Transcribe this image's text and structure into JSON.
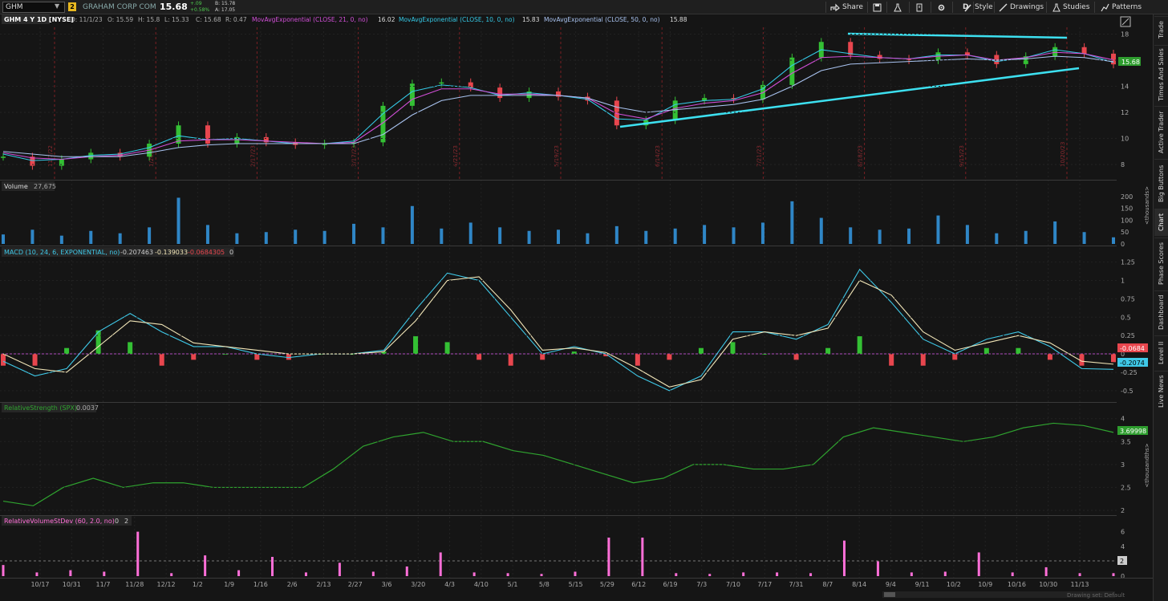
{
  "symbol": "GHM",
  "link_badge": "2",
  "company": "GRAHAM CORP COM",
  "last_price": "15.68",
  "change_abs": "+.09",
  "change_pct": "+0.58%",
  "bid": "B: 15.78",
  "ask": "A: 17.05",
  "toolbar": {
    "share": "Share",
    "period": "D",
    "style": "Style",
    "drawings": "Drawings",
    "studies": "Studies",
    "patterns": "Patterns"
  },
  "price_header": {
    "title": "GHM 4 Y 1D [NYSE]",
    "ohlc": [
      "D: 11/1/23",
      "O: 15.59",
      "H: 15.8",
      "L: 15.33",
      "C: 15.68",
      "R: 0.47"
    ],
    "ema21": "MovAvgExponential (CLOSE, 21, 0, no)",
    "ema21_val": "16.02",
    "ema10": "MovAvgExponential (CLOSE, 10, 0, no)",
    "ema10_val": "15.83",
    "ema50": "MovAvgExponential (CLOSE, 50, 0, no)",
    "ema50_val": "15.88"
  },
  "price_axis": [
    "18",
    "16",
    "14",
    "12",
    "10",
    "8"
  ],
  "price_badge": "15.68",
  "volume_header": {
    "title": "Volume",
    "value": "27,675"
  },
  "volume_axis": [
    "200",
    "150",
    "100",
    "50",
    "0"
  ],
  "volume_unit": "<thousands>",
  "macd_header": {
    "title": "MACD (10, 24, 6, EXPONENTIAL, no)",
    "v1": "-0.207463",
    "v2": "-0.139033",
    "v3": "-0.0684305",
    "v4": "0"
  },
  "macd_axis": [
    "1.25",
    "1",
    "0.75",
    "0.5",
    "0.25",
    "0",
    "-0.25",
    "-0.5"
  ],
  "macd_badges": [
    "-0.0684",
    "-0.2074"
  ],
  "rs_header": {
    "title": "RelativeStrength (SPX)",
    "value": "0.0037"
  },
  "rs_axis": [
    "4",
    "3.5",
    "3",
    "2.5",
    "2"
  ],
  "rs_badge": "3.69998",
  "rs_unit": "<thousandths>",
  "rvsd_header": {
    "title": "RelativeVolumeStDev (60, 2.0, no)",
    "v1": "0",
    "v2": "2"
  },
  "rvsd_axis": [
    "6",
    "4",
    "2",
    "0"
  ],
  "rvsd_badge": "2",
  "x_axis": [
    "10/17",
    "10/31",
    "11/7",
    "11/28",
    "12/12",
    "1/2",
    "1/9",
    "1/16",
    "2/6",
    "2/13",
    "2/27",
    "3/6",
    "3/20",
    "4/3",
    "4/10",
    "5/1",
    "5/8",
    "5/15",
    "5/29",
    "6/12",
    "6/19",
    "7/3",
    "7/10",
    "7/17",
    "7/31",
    "8/7",
    "8/14",
    "9/4",
    "9/11",
    "10/2",
    "10/9",
    "10/16",
    "10/30",
    "11/13"
  ],
  "earnings_labels": [
    "11/7/22",
    "1/26/23",
    "2/17/23",
    "3/17/23",
    "4/21/23",
    "5/19/23",
    "6/14/23",
    "7/21/23",
    "8/18/23",
    "9/15/23",
    "10/20/23"
  ],
  "footer_drawing_set": "Drawing set: Default",
  "sidebar": [
    "Trade",
    "Times And Sales",
    "Active Trader",
    "Big Buttons",
    "Chart",
    "Phase Scores",
    "Dashboard",
    "Level II",
    "Live News"
  ],
  "colors": {
    "up": "#34c034",
    "down": "#e8464e",
    "ema21": "#d24fd8",
    "ema10": "#35c9e6",
    "ema50": "#a9c3f0",
    "trendline": "#3de0f0",
    "macd_line": "#3fc9e8",
    "signal_line": "#f2e6b8",
    "rs": "#2fa32f",
    "volume": "#2f86c6",
    "rvsd": "#ff6fd8"
  },
  "chart_data": [
    {
      "type": "candlestick",
      "title": "GHM 4 Y 1D [NYSE]",
      "ylim": [
        7.2,
        18.4
      ],
      "x_ticks": [
        "10/17",
        "10/31",
        "11/7",
        "11/28",
        "12/12",
        "1/2",
        "1/9",
        "1/16",
        "2/6",
        "2/13",
        "2/27",
        "3/6",
        "3/20",
        "4/3",
        "4/10",
        "5/1",
        "5/8",
        "5/15",
        "5/29",
        "6/12",
        "6/19",
        "7/3",
        "7/10",
        "7/17",
        "7/31",
        "8/7",
        "8/14",
        "9/4",
        "9/11",
        "10/2",
        "10/9",
        "10/16",
        "10/30",
        "11/13"
      ],
      "series": [
        {
          "name": "Close",
          "values": [
            8.6,
            7.9,
            8.4,
            8.9,
            8.6,
            9.6,
            11.0,
            9.6,
            10.1,
            9.7,
            9.5,
            9.6,
            9.7,
            12.5,
            14.2,
            14.3,
            13.9,
            13.1,
            13.6,
            13.2,
            12.9,
            11.0,
            11.4,
            12.9,
            13.1,
            13.0,
            14.1,
            16.2,
            17.4,
            16.4,
            16.1,
            16.0,
            16.6,
            16.4,
            15.7,
            16.3,
            17.0,
            16.5,
            15.68
          ]
        },
        {
          "name": "MovAvgExponential (CLOSE, 10, 0, no)",
          "values": [
            8.8,
            8.3,
            8.4,
            8.7,
            8.8,
            9.3,
            10.2,
            9.9,
            10.0,
            9.8,
            9.6,
            9.6,
            9.8,
            11.9,
            13.6,
            14.1,
            13.9,
            13.3,
            13.5,
            13.3,
            13.0,
            11.5,
            11.4,
            12.6,
            12.9,
            13.0,
            13.8,
            15.6,
            16.8,
            16.5,
            16.2,
            16.1,
            16.4,
            16.4,
            15.9,
            16.2,
            16.8,
            16.5,
            15.83
          ]
        },
        {
          "name": "MovAvgExponential (CLOSE, 21, 0, no)",
          "values": [
            8.9,
            8.5,
            8.4,
            8.6,
            8.7,
            9.1,
            9.8,
            9.9,
            9.9,
            9.8,
            9.7,
            9.6,
            9.7,
            11.2,
            13.0,
            13.8,
            13.8,
            13.4,
            13.4,
            13.3,
            13.1,
            11.9,
            11.5,
            12.3,
            12.7,
            12.9,
            13.5,
            15.0,
            16.2,
            16.3,
            16.2,
            16.1,
            16.3,
            16.4,
            16.0,
            16.2,
            16.6,
            16.5,
            16.02
          ]
        },
        {
          "name": "MovAvgExponential (CLOSE, 50, 0, no)",
          "values": [
            9.0,
            8.8,
            8.6,
            8.6,
            8.6,
            8.9,
            9.3,
            9.5,
            9.6,
            9.6,
            9.6,
            9.6,
            9.6,
            10.3,
            11.8,
            12.9,
            13.3,
            13.3,
            13.3,
            13.3,
            13.1,
            12.4,
            12.0,
            12.2,
            12.4,
            12.6,
            13.0,
            14.0,
            15.2,
            15.7,
            15.8,
            15.9,
            16.0,
            16.1,
            16.0,
            16.1,
            16.3,
            16.2,
            15.88
          ]
        }
      ]
    },
    {
      "type": "bar",
      "title": "Volume",
      "ylabel": "<thousands>",
      "ylim": [
        0,
        210
      ],
      "series": [
        {
          "name": "Volume",
          "values": [
            40,
            60,
            35,
            55,
            45,
            70,
            195,
            80,
            45,
            50,
            60,
            55,
            85,
            70,
            160,
            65,
            90,
            70,
            55,
            60,
            45,
            75,
            55,
            65,
            80,
            70,
            90,
            180,
            110,
            70,
            60,
            65,
            120,
            80,
            45,
            55,
            95,
            50,
            28
          ]
        }
      ]
    },
    {
      "type": "line",
      "title": "MACD (10, 24, 6, EXPONENTIAL, no)",
      "ylim": [
        -0.6,
        1.3
      ],
      "series": [
        {
          "name": "Value",
          "values": [
            -0.1,
            -0.3,
            -0.2,
            0.3,
            0.55,
            0.3,
            0.1,
            0.1,
            0.0,
            -0.05,
            0.0,
            0.0,
            0.05,
            0.6,
            1.1,
            1.0,
            0.5,
            0.0,
            0.1,
            0.0,
            -0.3,
            -0.5,
            -0.3,
            0.3,
            0.3,
            0.2,
            0.4,
            1.15,
            0.7,
            0.2,
            0.0,
            0.2,
            0.3,
            0.1,
            -0.2,
            -0.21
          ]
        },
        {
          "name": "Avg",
          "values": [
            0.0,
            -0.2,
            -0.25,
            0.1,
            0.45,
            0.4,
            0.15,
            0.1,
            0.05,
            0.0,
            0.0,
            0.0,
            0.03,
            0.45,
            1.0,
            1.05,
            0.6,
            0.05,
            0.08,
            0.02,
            -0.2,
            -0.45,
            -0.35,
            0.2,
            0.3,
            0.25,
            0.35,
            1.0,
            0.8,
            0.3,
            0.05,
            0.15,
            0.25,
            0.15,
            -0.1,
            -0.14
          ]
        }
      ]
    },
    {
      "type": "line",
      "title": "RelativeStrength (SPX)",
      "ylabel": "<thousandths>",
      "ylim": [
        2.0,
        4.1
      ],
      "series": [
        {
          "name": "RelativeStrength (SPX)",
          "values": [
            2.2,
            2.1,
            2.5,
            2.7,
            2.5,
            2.6,
            2.6,
            2.5,
            2.5,
            2.5,
            2.5,
            2.9,
            3.4,
            3.6,
            3.7,
            3.5,
            3.5,
            3.3,
            3.2,
            3.0,
            2.8,
            2.6,
            2.7,
            3.0,
            3.0,
            2.9,
            2.9,
            3.0,
            3.6,
            3.8,
            3.7,
            3.6,
            3.5,
            3.6,
            3.8,
            3.9,
            3.85,
            3.7
          ]
        }
      ]
    },
    {
      "type": "bar",
      "title": "RelativeVolumeStDev (60, 2.0, no)",
      "ylim": [
        0,
        6.5
      ],
      "series": [
        {
          "name": "RelativeVolumeStDev",
          "values": [
            1.5,
            0.5,
            0.8,
            0.6,
            6.0,
            0.4,
            2.8,
            0.8,
            2.6,
            0.5,
            1.8,
            0.6,
            1.3,
            3.2,
            0.5,
            0.4,
            0.3,
            0.6,
            5.2,
            5.2,
            0.4,
            0.3,
            0.5,
            0.5,
            0.4,
            4.8,
            2.0,
            0.5,
            0.6,
            3.2,
            0.5,
            1.2,
            0.4,
            0.4
          ]
        }
      ]
    }
  ]
}
